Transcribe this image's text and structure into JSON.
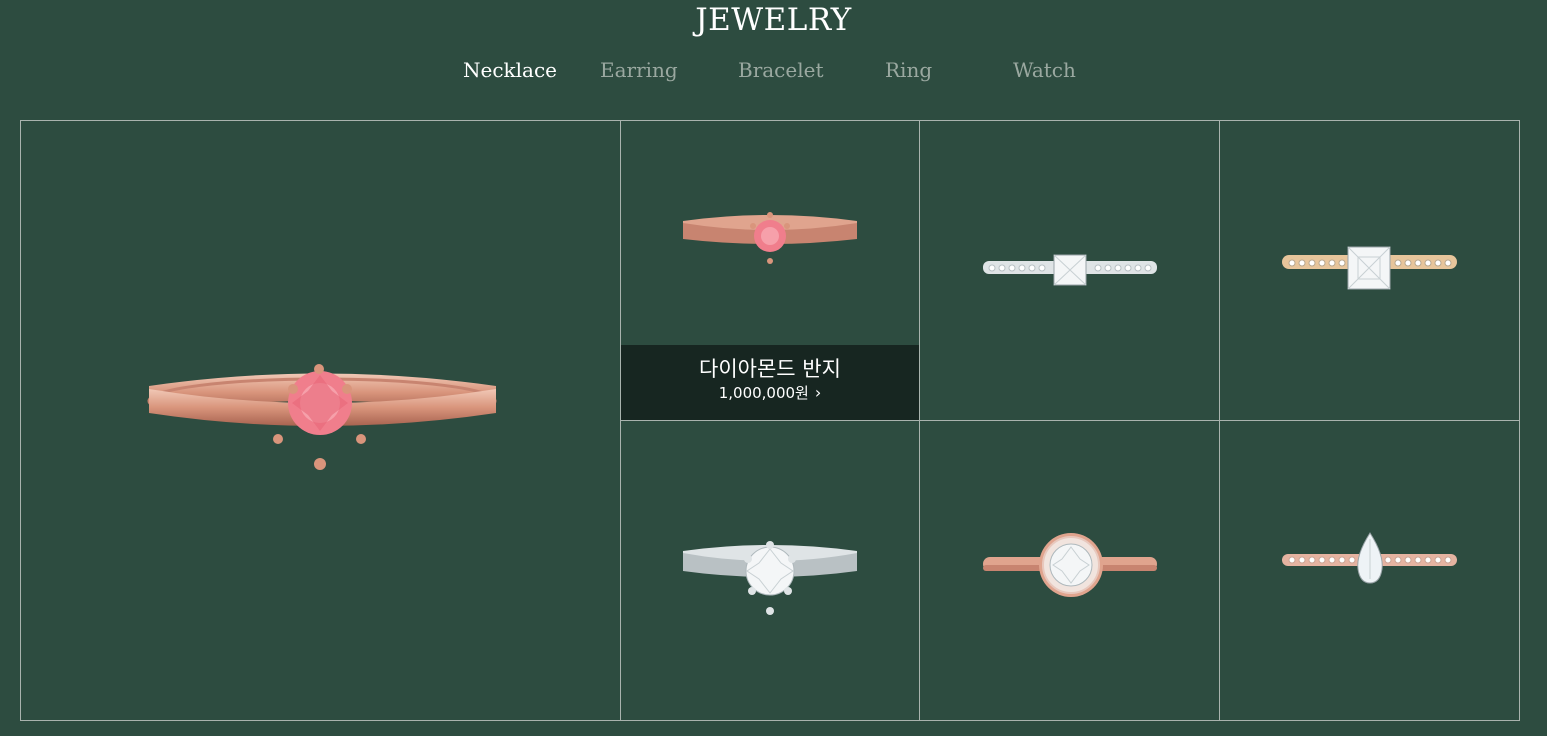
{
  "header": {
    "title": "JEWELRY"
  },
  "tabs": [
    {
      "label": "Necklace",
      "active": true
    },
    {
      "label": "Earring",
      "active": false
    },
    {
      "label": "Bracelet",
      "active": false
    },
    {
      "label": "Ring",
      "active": false
    },
    {
      "label": "Watch",
      "active": false
    }
  ],
  "featured": {
    "name": "다이아몬드 반지",
    "price": "1,000,000원",
    "chevron": "›"
  },
  "products": [
    {
      "icon": "rose-gold-pink-solitaire-ring-icon",
      "metal": "#e0a48e",
      "stone": "#f07e8c"
    },
    {
      "icon": "rose-gold-pink-solitaire-ring-icon",
      "metal": "#e0a48e",
      "stone": "#f07e8c"
    },
    {
      "icon": "white-gold-princess-eternity-ring-icon",
      "metal": "#dfe4e6",
      "stone": "#f4f6f7"
    },
    {
      "icon": "yellow-gold-princess-eternity-ring-icon",
      "metal": "#e7c59b",
      "stone": "#f4f6f7"
    },
    {
      "icon": "white-gold-solitaire-ring-icon",
      "metal": "#dfe4e6",
      "stone": "#f4f6f7"
    },
    {
      "icon": "rose-gold-halo-ring-icon",
      "metal": "#e0a48e",
      "stone": "#f4f6f7"
    },
    {
      "icon": "rose-gold-pear-eternity-ring-icon",
      "metal": "#e5b3a1",
      "stone": "#eef3f6"
    }
  ],
  "colors": {
    "background": "#2d4c40",
    "grid_line": "#a9b3ae",
    "overlay": "#172621",
    "active_tab": "#ffffff",
    "inactive_tab": "#9aa8a0"
  }
}
